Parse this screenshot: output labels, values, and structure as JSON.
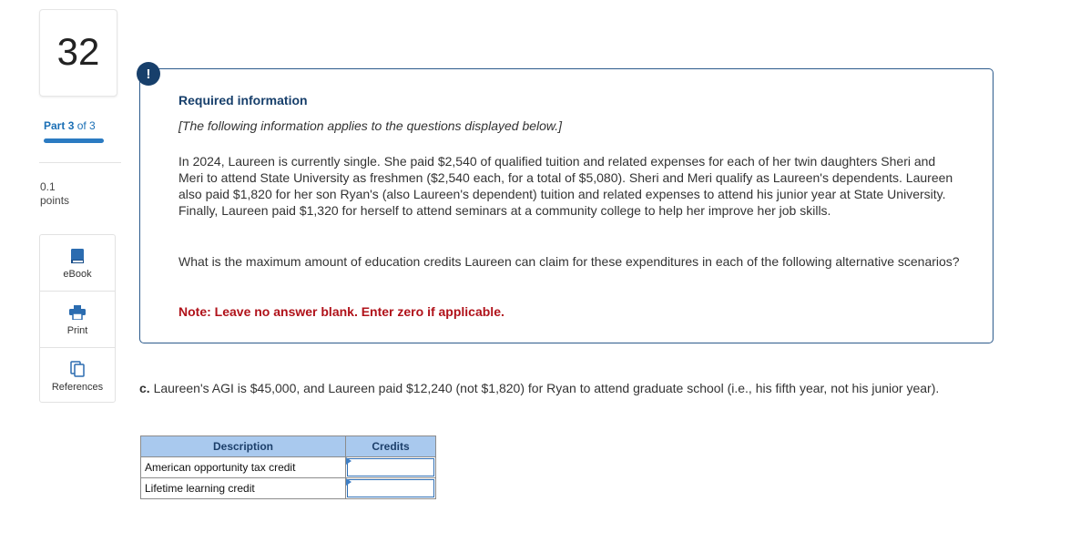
{
  "question": {
    "number": "32",
    "part_label": "Part",
    "part_current": "3",
    "part_of": "of 3",
    "points_value": "0.1",
    "points_label": "points"
  },
  "tools": [
    {
      "label": "eBook",
      "icon": "book-icon"
    },
    {
      "label": "Print",
      "icon": "printer-icon"
    },
    {
      "label": "References",
      "icon": "references-icon"
    }
  ],
  "info": {
    "icon_text": "!",
    "title": "Required information",
    "subtitle": "[The following information applies to the questions displayed below.]",
    "scenario": "In 2024, Laureen is currently single. She paid $2,540 of qualified tuition and related expenses for each of her twin daughters Sheri and Meri to attend State University as freshmen ($2,540 each, for a total of $5,080). Sheri and Meri qualify as Laureen's dependents. Laureen also paid $1,820 for her son Ryan's (also Laureen's dependent) tuition and related expenses to attend his junior year at State University. Finally, Laureen paid $1,320 for herself to attend seminars at a community college to help her improve her job skills.",
    "question": "What is the maximum amount of education credits Laureen can claim for these expenditures in each of the following alternative scenarios?",
    "note": "Note: Leave no answer blank. Enter zero if applicable."
  },
  "part_c": {
    "letter": "c.",
    "text": "Laureen's AGI is $45,000, and Laureen paid $12,240 (not $1,820) for Ryan to attend graduate school (i.e., his fifth year, not his junior year)."
  },
  "table": {
    "headers": [
      "Description",
      "Credits"
    ],
    "rows": [
      {
        "description": "American opportunity tax credit",
        "credits": ""
      },
      {
        "description": "Lifetime learning credit",
        "credits": ""
      }
    ]
  },
  "colors": {
    "accent_blue": "#2b7bc2",
    "info_icon": "#173f6b",
    "note_red": "#b0121a",
    "table_header": "#a9c9ee"
  }
}
